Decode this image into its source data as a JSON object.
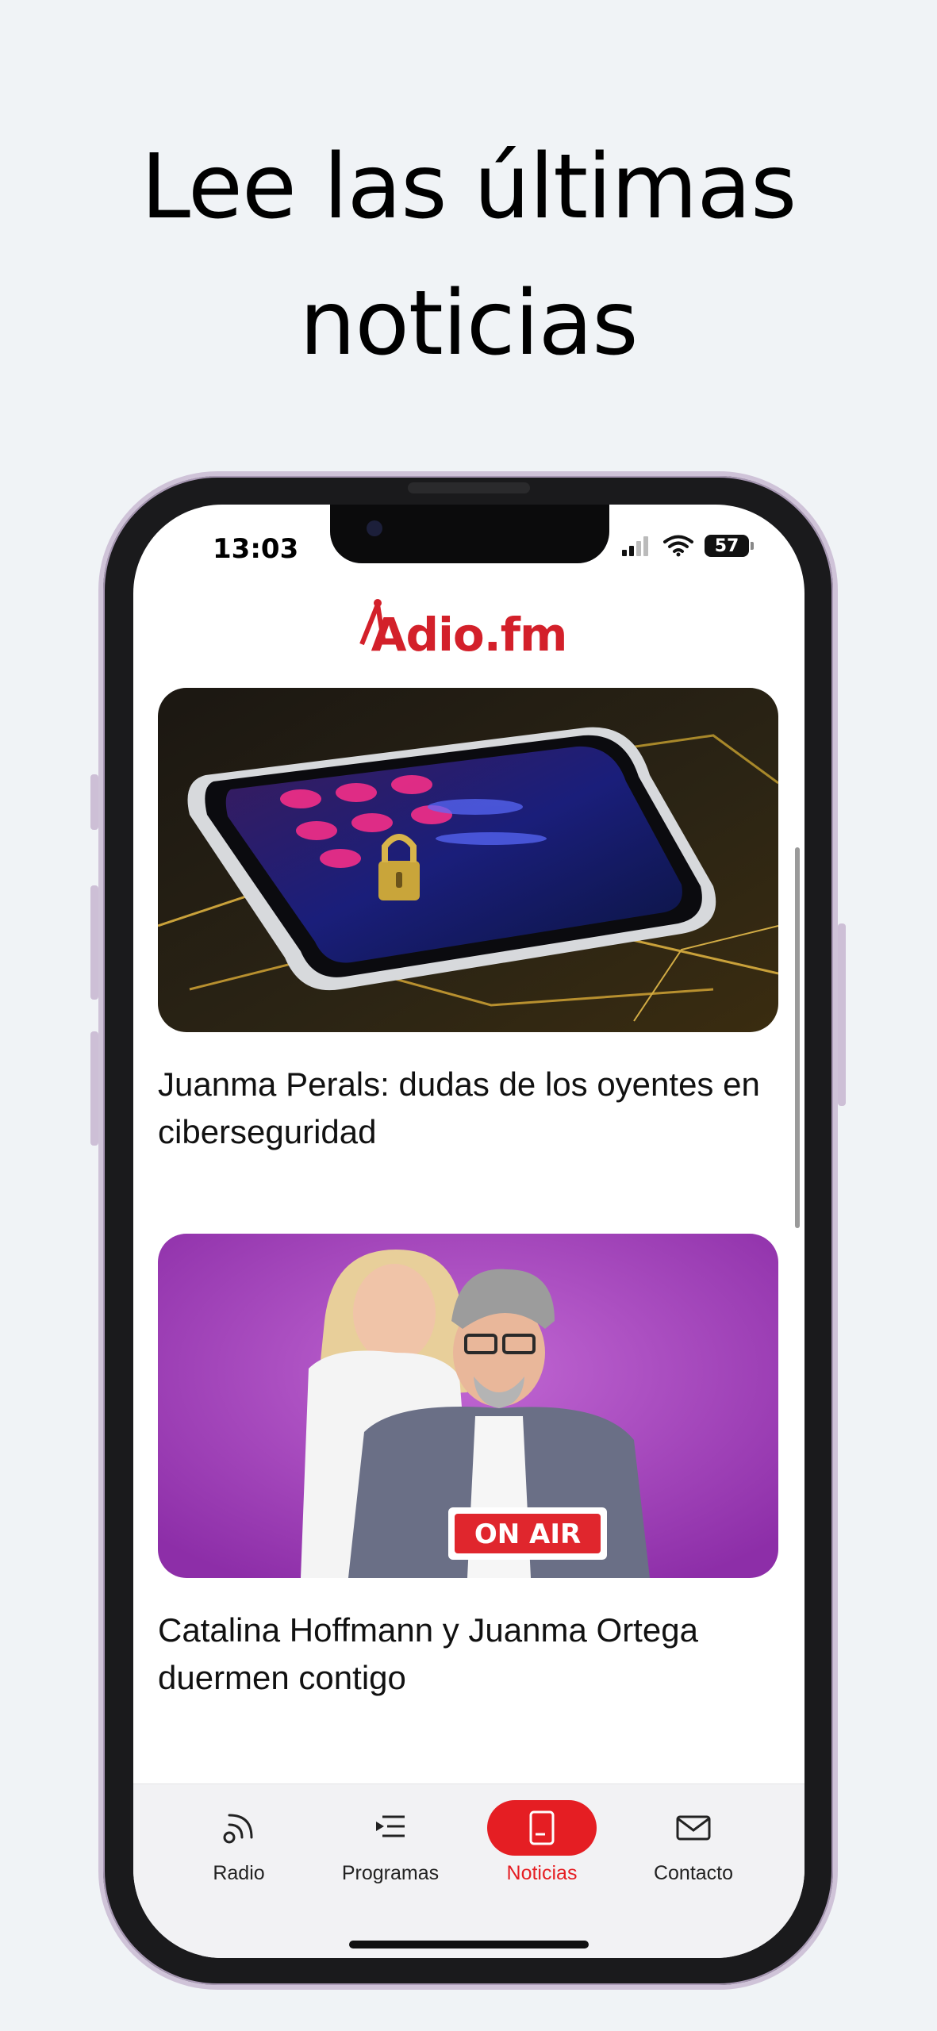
{
  "promo": {
    "headline_line1": "Lee las últimas",
    "headline_line2": "noticias"
  },
  "status_bar": {
    "time": "13:03",
    "battery": "57"
  },
  "app": {
    "logo_text": "Adio.fm",
    "brand_color": "#d3202a"
  },
  "news": [
    {
      "title": "Juanma Perals: dudas de los oyentes en ciberseguridad",
      "image": "smartphone-with-padlock-on-circuit-board"
    },
    {
      "title": "Catalina Hoffmann y Juanma Ortega duermen contigo",
      "image": "two-presenters-on-purple-background",
      "sign_text": "ON AIR"
    }
  ],
  "tabs": [
    {
      "label": "Radio",
      "icon": "radio-waves-icon"
    },
    {
      "label": "Programas",
      "icon": "play-list-icon"
    },
    {
      "label": "Noticias",
      "icon": "news-document-icon",
      "active": true
    },
    {
      "label": "Contacto",
      "icon": "envelope-icon"
    }
  ],
  "colors": {
    "accent": "#e51e23",
    "page_background": "#f0f3f6"
  }
}
